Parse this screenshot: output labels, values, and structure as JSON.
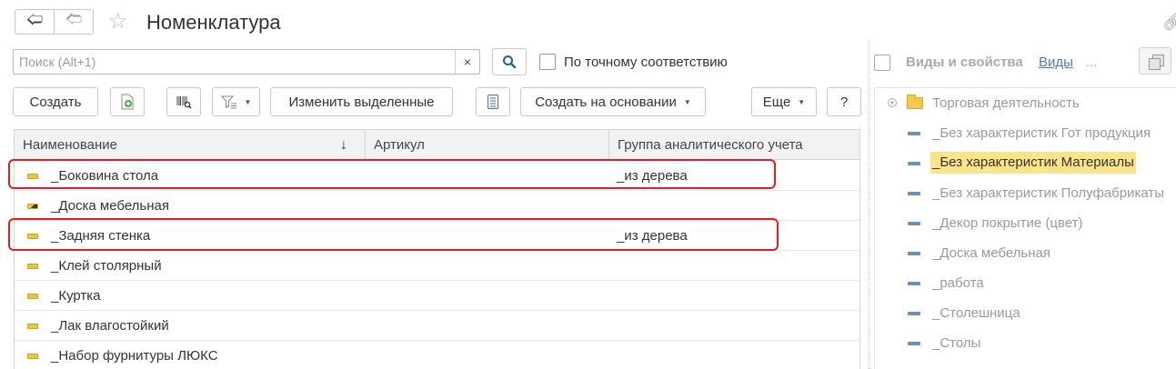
{
  "window": {
    "title": "Номенклатура",
    "back_icon": "arrow-left-icon",
    "forward_icon": "arrow-right-icon",
    "favorite_icon": "star-icon"
  },
  "search": {
    "placeholder": "Поиск (Alt+1)",
    "value": "",
    "clear_label": "×",
    "exact_match_label": "По точному соответствию",
    "exact_match_checked": false
  },
  "toolbar": {
    "create_label": "Создать",
    "edit_selected_label": "Изменить выделенные",
    "create_based_on_label": "Создать на основании",
    "more_label": "Еще",
    "help_label": "?"
  },
  "table": {
    "columns": [
      "Наименование",
      "Артикул",
      "Группа аналитического учета"
    ],
    "sort_indicator": "↓",
    "rows": [
      {
        "name": "_Боковина стола",
        "article": "",
        "group": "_из дерева",
        "icon": "item-icon",
        "highlighted": true
      },
      {
        "name": "_Доска мебельная",
        "article": "",
        "group": "",
        "icon": "item-set-icon",
        "highlighted": false
      },
      {
        "name": "_Задняя стенка",
        "article": "",
        "group": "_из дерева",
        "icon": "item-icon",
        "highlighted": true
      },
      {
        "name": "_Клей столярный",
        "article": "",
        "group": "",
        "icon": "item-icon",
        "highlighted": false
      },
      {
        "name": "_Куртка",
        "article": "",
        "group": "",
        "icon": "item-icon",
        "highlighted": false
      },
      {
        "name": "_Лак влагостойкий",
        "article": "",
        "group": "",
        "icon": "item-icon",
        "highlighted": false
      },
      {
        "name": "_Набор фурнитуры ЛЮКС",
        "article": "",
        "group": "",
        "icon": "item-icon",
        "highlighted": false
      }
    ]
  },
  "right_panel": {
    "title": "Виды и свойства",
    "link_label": "Виды",
    "ellipsis": "...",
    "tree": [
      {
        "label": "Торговая деятельность",
        "type": "folder",
        "selected": false
      },
      {
        "label": "_Без характеристик Гот продукция",
        "type": "item",
        "selected": false
      },
      {
        "label": "_Без характеристик Материалы",
        "type": "item",
        "selected": true
      },
      {
        "label": "_Без характеристик Полуфабрикаты",
        "type": "item",
        "selected": false
      },
      {
        "label": "_Декор покрытие (цвет)",
        "type": "item",
        "selected": false
      },
      {
        "label": "_Доска мебельная",
        "type": "item",
        "selected": false
      },
      {
        "label": "_работа",
        "type": "item",
        "selected": false
      },
      {
        "label": "_Столешница",
        "type": "item",
        "selected": false
      },
      {
        "label": "_Столы",
        "type": "item",
        "selected": false
      }
    ]
  },
  "colors": {
    "highlight_border": "#e02020",
    "selected_background": "#fbe38a",
    "link": "#4a7dbf"
  }
}
